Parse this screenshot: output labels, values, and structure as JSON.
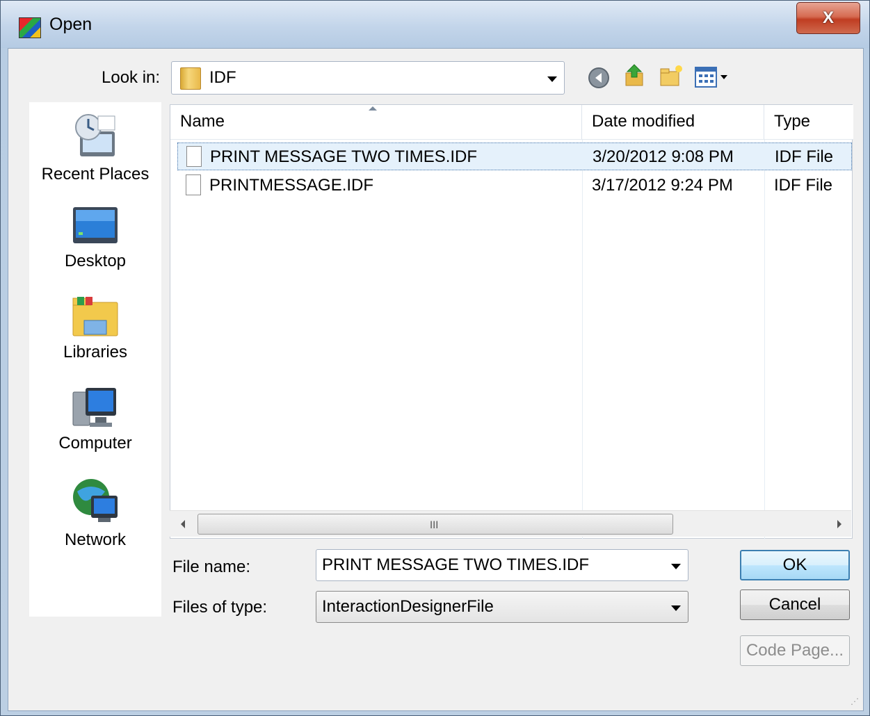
{
  "window": {
    "title": "Open",
    "close_label": "X"
  },
  "toolbar": {
    "look_in_label": "Look in:",
    "look_in_value": "IDF"
  },
  "places": [
    {
      "label": "Recent Places",
      "icon": "recent-places-icon"
    },
    {
      "label": "Desktop",
      "icon": "desktop-icon"
    },
    {
      "label": "Libraries",
      "icon": "libraries-icon"
    },
    {
      "label": "Computer",
      "icon": "computer-icon"
    },
    {
      "label": "Network",
      "icon": "network-icon"
    }
  ],
  "columns": [
    "Name",
    "Date modified",
    "Type"
  ],
  "files": [
    {
      "name": "PRINT MESSAGE TWO TIMES.IDF",
      "date": "3/20/2012 9:08 PM",
      "type": "IDF File",
      "selected": true
    },
    {
      "name": "PRINTMESSAGE.IDF",
      "date": "3/17/2012 9:24 PM",
      "type": "IDF File",
      "selected": false
    }
  ],
  "scrollbar_grip": "III",
  "form": {
    "file_name_label": "File name:",
    "file_name_value": "PRINT MESSAGE TWO TIMES.IDF",
    "file_type_label": "Files of type:",
    "file_type_value": "InteractionDesignerFile"
  },
  "buttons": {
    "ok": "OK",
    "cancel": "Cancel",
    "code_page": "Code Page..."
  }
}
